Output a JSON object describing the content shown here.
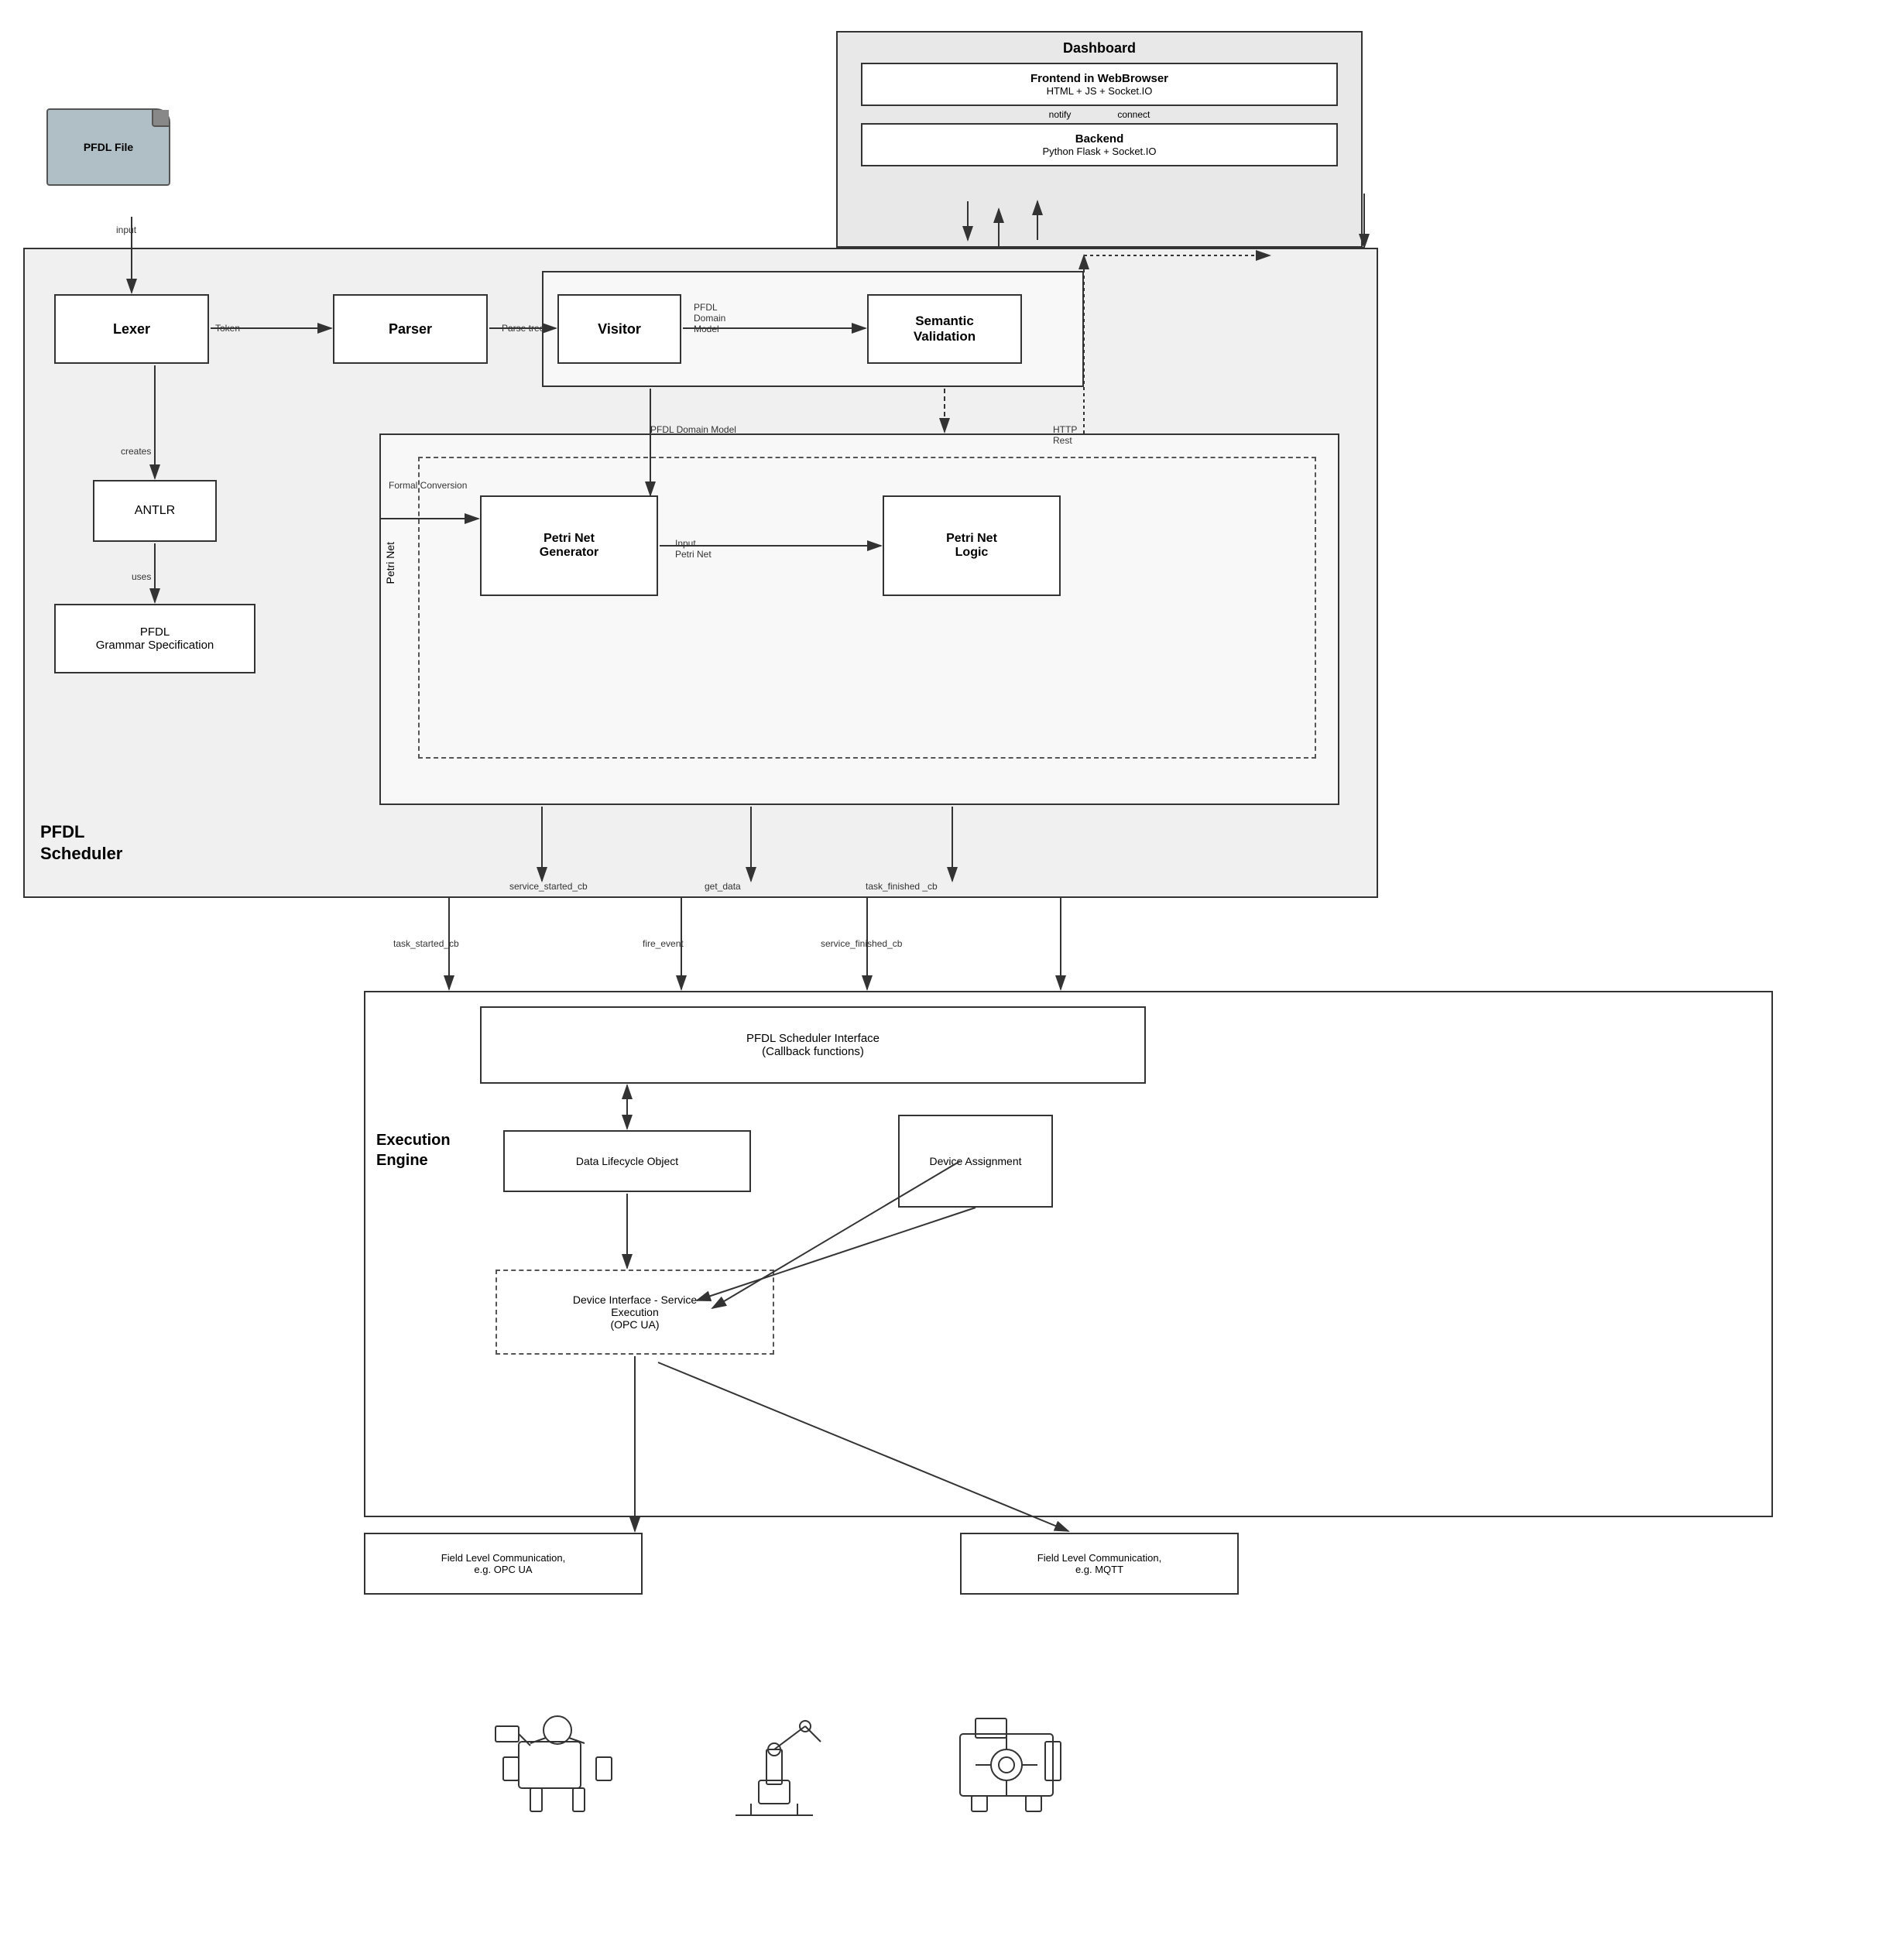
{
  "dashboard": {
    "title": "Dashboard",
    "frontend": {
      "title": "Frontend in WebBrowser",
      "subtitle": "HTML + JS + Socket.IO"
    },
    "backend": {
      "title": "Backend",
      "subtitle": "Python Flask + Socket.IO"
    },
    "notify_label": "notify",
    "connect_label": "connect"
  },
  "pfdl_file": {
    "label": "PFDL File"
  },
  "scheduler": {
    "label_line1": "PFDL",
    "label_line2": "Scheduler"
  },
  "lexer": {
    "label": "Lexer"
  },
  "parser": {
    "label": "Parser"
  },
  "visitor": {
    "label": "Visitor"
  },
  "semantic": {
    "label": "Semantic\nValidation"
  },
  "antlr": {
    "label": "ANTLR"
  },
  "grammar": {
    "label": "PFDL\nGrammar Specification"
  },
  "petrinet": {
    "outer_label": "Petri Net",
    "generator_label": "Petri Net\nGenerator",
    "logic_label": "Petri Net\nLogic"
  },
  "arrows": {
    "input_label": "input",
    "token_label": "Token",
    "parse_tree_label": "Parse tree",
    "pfdl_domain_model_label": "PFDL\nDomain\nModel",
    "pfdl_domain_model_bottom": "PFDL Domain Model",
    "input_petri_net": "Input\nPetri Net",
    "formal_conversion": "Formal Conversion",
    "creates_label": "creates",
    "uses_label": "uses",
    "http_rest_label": "HTTP\nRest",
    "service_started_cb": "service_started_cb",
    "get_data": "get_data",
    "task_finished_cb": "task_finished _cb",
    "task_started_cb": "task_started_cb",
    "fire_event": "fire_event",
    "service_finished_cb": "service_finished_cb"
  },
  "execution_engine": {
    "label": "Execution\nEngine",
    "pfdl_interface_label": "PFDL Scheduler Interface\n(Callback functions)",
    "data_lifecycle_label": "Data Lifecycle Object",
    "device_assignment_label": "Device\nAssignment",
    "device_interface_label": "Device Interface - Service\nExecution\n(OPC UA)"
  },
  "field_comm": {
    "left_label": "Field Level Communication,\ne.g. OPC UA",
    "right_label": "Field Level Communication,\ne.g. MQTT"
  }
}
